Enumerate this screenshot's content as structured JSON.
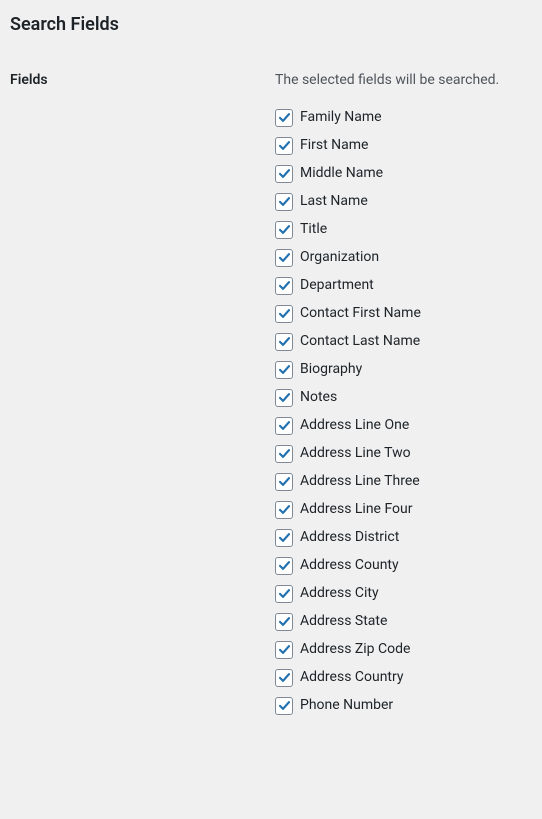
{
  "section_title": "Search Fields",
  "side_label": "Fields",
  "description": "The selected fields will be searched.",
  "check_color": "#2271b1",
  "fields": [
    {
      "label": "Family Name",
      "checked": true
    },
    {
      "label": "First Name",
      "checked": true
    },
    {
      "label": "Middle Name",
      "checked": true
    },
    {
      "label": "Last Name",
      "checked": true
    },
    {
      "label": "Title",
      "checked": true
    },
    {
      "label": "Organization",
      "checked": true
    },
    {
      "label": "Department",
      "checked": true
    },
    {
      "label": "Contact First Name",
      "checked": true
    },
    {
      "label": "Contact Last Name",
      "checked": true
    },
    {
      "label": "Biography",
      "checked": true
    },
    {
      "label": "Notes",
      "checked": true
    },
    {
      "label": "Address Line One",
      "checked": true
    },
    {
      "label": "Address Line Two",
      "checked": true
    },
    {
      "label": "Address Line Three",
      "checked": true
    },
    {
      "label": "Address Line Four",
      "checked": true
    },
    {
      "label": "Address District",
      "checked": true
    },
    {
      "label": "Address County",
      "checked": true
    },
    {
      "label": "Address City",
      "checked": true
    },
    {
      "label": "Address State",
      "checked": true
    },
    {
      "label": "Address Zip Code",
      "checked": true
    },
    {
      "label": "Address Country",
      "checked": true
    },
    {
      "label": "Phone Number",
      "checked": true
    }
  ]
}
